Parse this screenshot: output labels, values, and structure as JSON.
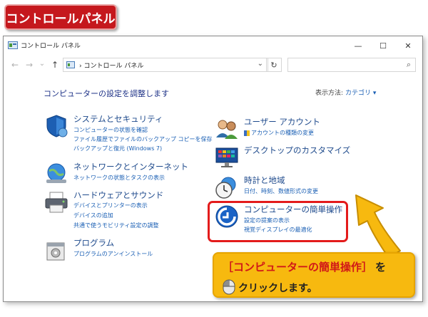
{
  "banner": {
    "label": "コントロールパネル"
  },
  "window": {
    "title": "コントロール パネル",
    "controls": {
      "minimize": "—",
      "maximize": "☐",
      "close": "✕"
    }
  },
  "addressbar": {
    "back": "←",
    "forward": "→",
    "recent": "⌄",
    "up": "↑",
    "path": "› コントロール パネル",
    "dropdown": "⌄",
    "refresh": "↻",
    "search_placeholder": "",
    "search_icon": "⌕"
  },
  "main": {
    "heading": "コンピューターの設定を調整します",
    "view_by_label": "表示方法:",
    "view_by_value": "カテゴリ ▾"
  },
  "categories": [
    {
      "icon": "shield-icon",
      "title": "システムとセキュリティ",
      "links": [
        "コンピューターの状態を確認",
        "ファイル履歴でファイルのバックアップ コピーを保存",
        "バックアップと復元 (Windows 7)"
      ]
    },
    {
      "icon": "network-icon",
      "title": "ネットワークとインターネット",
      "links": [
        "ネットワークの状態とタスクの表示"
      ]
    },
    {
      "icon": "printer-icon",
      "title": "ハードウェアとサウンド",
      "links": [
        "デバイスとプリンターの表示",
        "デバイスの追加",
        "共通で使うモビリティ設定の調整"
      ]
    },
    {
      "icon": "programs-icon",
      "title": "プログラム",
      "links": [
        "プログラムのアンインストール"
      ]
    },
    {
      "icon": "users-icon",
      "title": "ユーザー アカウント",
      "links": [
        "アカウントの種類の変更"
      ]
    },
    {
      "icon": "desktop-icon",
      "title": "デスクトップのカスタマイズ",
      "links": []
    },
    {
      "icon": "clock-icon",
      "title": "時計と地域",
      "links": [
        "日付、時刻、数値形式の変更"
      ]
    },
    {
      "icon": "accessibility-icon",
      "title": "コンピューターの簡単操作",
      "links": [
        "設定の提案の表示",
        "視覚ディスプレイの最適化"
      ]
    }
  ],
  "callout": {
    "highlight": "［コンピューターの簡単操作］",
    "suffix": "を",
    "line2": "クリックします。"
  },
  "colors": {
    "banner": "#c5181d",
    "callout": "#f7b90f",
    "highlight": "#e31b1b",
    "link": "#1a5fb4",
    "title": "#1e4a8c"
  }
}
